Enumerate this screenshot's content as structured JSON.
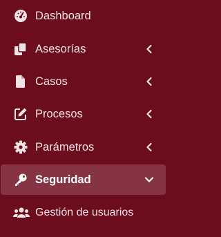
{
  "sidebar": {
    "items": [
      {
        "label": "Dashboard",
        "icon": "tachometer-icon"
      },
      {
        "label": "Asesorías",
        "icon": "copy-icon",
        "chevron": "chevron-left-icon"
      },
      {
        "label": "Casos",
        "icon": "file-icon",
        "chevron": "chevron-left-icon"
      },
      {
        "label": "Procesos",
        "icon": "edit-icon",
        "chevron": "chevron-left-icon"
      },
      {
        "label": "Parámetros",
        "icon": "gear-icon",
        "chevron": "chevron-left-icon"
      },
      {
        "label": "Seguridad",
        "icon": "key-icon",
        "chevron": "chevron-down-icon",
        "active": true
      },
      {
        "label": "Gestión de usuarios",
        "icon": "users-icon"
      }
    ]
  },
  "colors": {
    "background": "#6b0d1c",
    "active_background": "#863343",
    "text": "#efe3e5",
    "icon": "#efe3e5"
  }
}
